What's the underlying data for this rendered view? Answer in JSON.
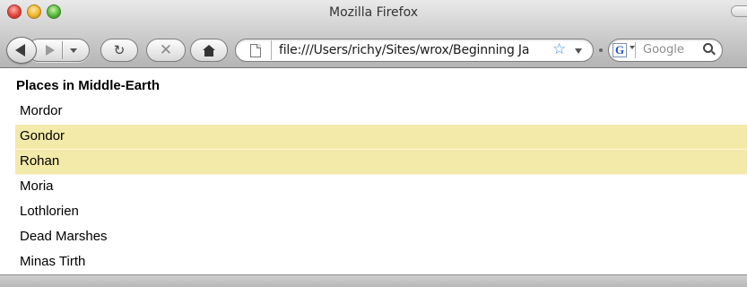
{
  "window": {
    "title": "Mozilla Firefox"
  },
  "toolbar": {
    "url": "file:///Users/richy/Sites/wrox/Beginning Ja",
    "search_placeholder": "Google",
    "search_engine_letter": "G"
  },
  "page": {
    "heading": "Places in Middle-Earth",
    "highlight_color": "#f3e9a9",
    "items": [
      {
        "label": "Mordor",
        "highlighted": false
      },
      {
        "label": "Gondor",
        "highlighted": true
      },
      {
        "label": "Rohan",
        "highlighted": true
      },
      {
        "label": "Moria",
        "highlighted": false
      },
      {
        "label": "Lothlorien",
        "highlighted": false
      },
      {
        "label": "Dead Marshes",
        "highlighted": false
      },
      {
        "label": "Minas Tirth",
        "highlighted": false
      }
    ]
  },
  "icons": {
    "back": "back-arrow-icon",
    "forward": "forward-arrow-icon",
    "reload": "reload-icon",
    "stop": "stop-icon",
    "home": "home-icon",
    "bookmark": "star-icon",
    "search": "magnifier-icon"
  }
}
